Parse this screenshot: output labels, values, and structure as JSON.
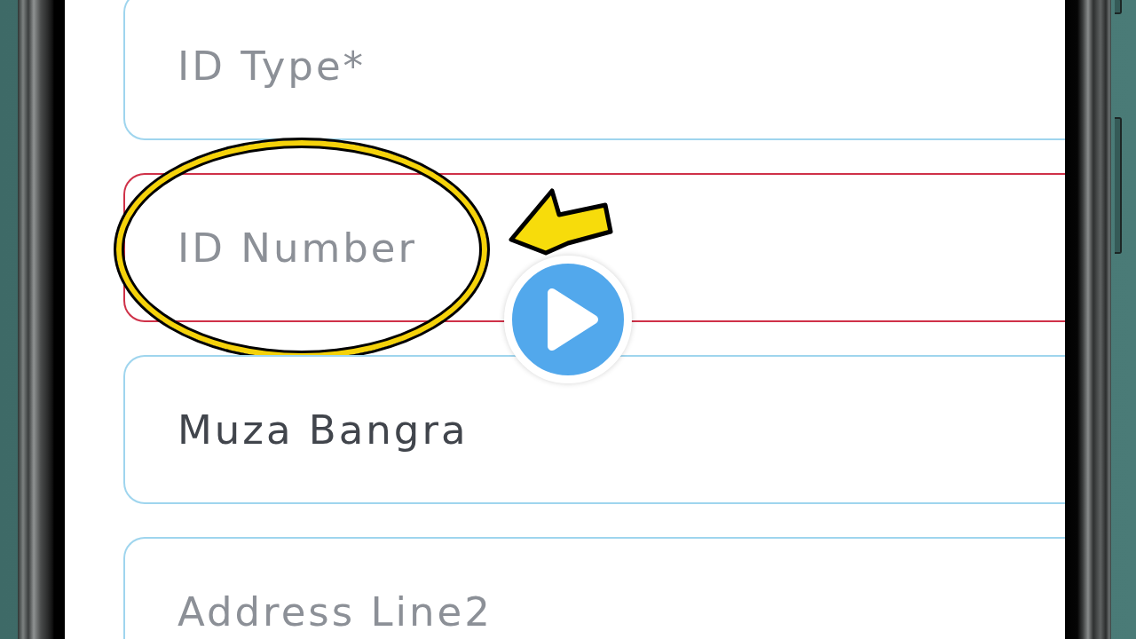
{
  "form": {
    "fields": [
      {
        "placeholder": "ID Type*",
        "error": false,
        "highlighted": false
      },
      {
        "placeholder": "ID Number",
        "error": true,
        "highlighted": true
      },
      {
        "value": "Muza Bangra",
        "error": false,
        "highlighted": false
      },
      {
        "placeholder": "Address Line2",
        "error": false,
        "highlighted": false
      }
    ]
  }
}
